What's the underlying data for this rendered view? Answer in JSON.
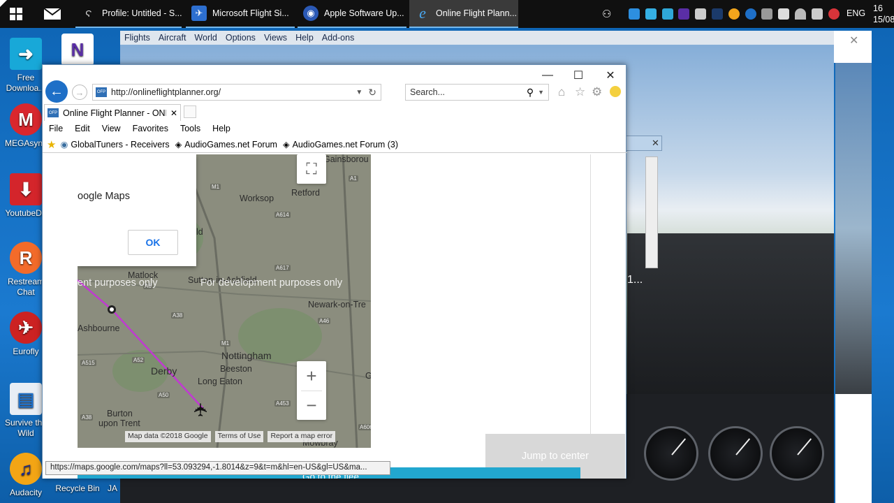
{
  "taskbar": {
    "apps": [
      {
        "label": "Profile: Untitled - S...",
        "icon": "profile-icon"
      },
      {
        "label": "Microsoft Flight Si...",
        "icon": "plane-icon"
      },
      {
        "label": "Apple Software Up...",
        "icon": "apple-update-icon"
      },
      {
        "label": "Online Flight Plann...",
        "icon": "ie-icon"
      }
    ],
    "language": "ENG",
    "clock_time": "16",
    "clock_date": "15/08/"
  },
  "desktop": {
    "icons": [
      {
        "label": "Free Downloa...",
        "icon": "download-arrow-icon"
      },
      {
        "label": "MEGAsync",
        "icon": "mega-icon"
      },
      {
        "label": "YoutubeDL",
        "icon": "youtube-dl-icon"
      },
      {
        "label": "Restream Chat",
        "icon": "restream-icon"
      },
      {
        "label": "Eurofly",
        "icon": "eurofly-icon"
      },
      {
        "label": "Survive the Wild",
        "icon": "survive-icon"
      },
      {
        "label": "Audacity",
        "icon": "audacity-icon"
      },
      {
        "label": "Recycle Bin",
        "icon": "recycle-bin-icon"
      },
      {
        "label": "JA",
        "icon": "ja-icon"
      }
    ]
  },
  "fsx": {
    "menu": [
      "Flights",
      "Aircraft",
      "World",
      "Options",
      "Views",
      "Help",
      "Add-ons"
    ],
    "dialog_text": "1..."
  },
  "ie": {
    "url": "http://onlineflightplanner.org/",
    "search_placeholder": "Search...",
    "tab_title": "Online Flight Planner - ONL...",
    "menu": [
      "File",
      "Edit",
      "View",
      "Favorites",
      "Tools",
      "Help"
    ],
    "favorites": [
      {
        "label": "GlobalTuners - Receivers"
      },
      {
        "label": "AudioGames.net Forum"
      },
      {
        "label": "AudioGames.net Forum (3)"
      }
    ],
    "status_url": "https://maps.google.com/maps?ll=53.093294,-1.8014&z=9&t=m&hl=en-US&gl=US&ma..."
  },
  "map": {
    "dialog_title": "oogle Maps",
    "dialog_ok": "OK",
    "watermark_left": "ent purposes only",
    "watermark_right": "For development purposes only",
    "towns": [
      "Gainsborou",
      "Retford",
      "Worksop",
      "ld",
      "Matlock",
      "Sutton-in-Ashfield",
      "Newark-on-Tre",
      "Ashbourne",
      "Nottingham",
      "Beeston",
      "Derby",
      "Long Eaton",
      "Burton",
      "upon Trent",
      "Mowbray",
      "G"
    ],
    "roads": [
      "M1",
      "A614",
      "A1",
      "A38",
      "A46",
      "A52",
      "M1",
      "A50",
      "A515",
      "A453",
      "A6",
      "A606",
      "A617",
      "A38"
    ],
    "attribution": [
      "Map data ©2018 Google",
      "Terms of Use",
      "Report a map error"
    ]
  },
  "page": {
    "jump_label": "Jump to center",
    "go_label": "Go to the flee"
  },
  "colors": {
    "route": "#c03ad1",
    "ie_accent": "#1e6fc7",
    "taskbar_active_line": "#76b9ed"
  }
}
